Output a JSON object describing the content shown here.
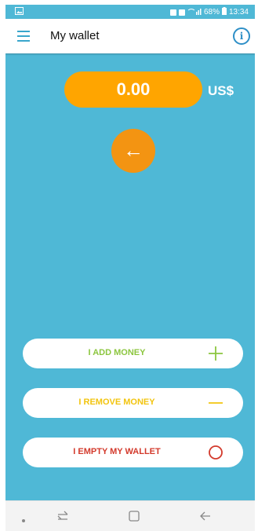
{
  "status_bar": {
    "battery": "68%",
    "time": "13:34"
  },
  "header": {
    "title": "My wallet",
    "info_symbol": "i"
  },
  "balance": {
    "amount": "0.00",
    "currency": "US$"
  },
  "back_button": {
    "icon": "arrow-left-icon",
    "glyph": "←"
  },
  "actions": [
    {
      "label": "I ADD MONEY",
      "color": "#8cc63f",
      "icon": "plus-icon"
    },
    {
      "label": "I REMOVE MONEY",
      "color": "#f2c40f",
      "icon": "minus-icon"
    },
    {
      "label": "I EMPTY MY WALLET",
      "color": "#d33a2c",
      "icon": "circle-icon"
    }
  ],
  "colors": {
    "background": "#4fb8d6",
    "balance_pill": "#ffa500",
    "back_circle": "#f39412",
    "info": "#2e8fc7"
  },
  "nav": {
    "icons": [
      "dot-icon",
      "recent-apps-icon",
      "home-icon",
      "back-icon"
    ]
  }
}
